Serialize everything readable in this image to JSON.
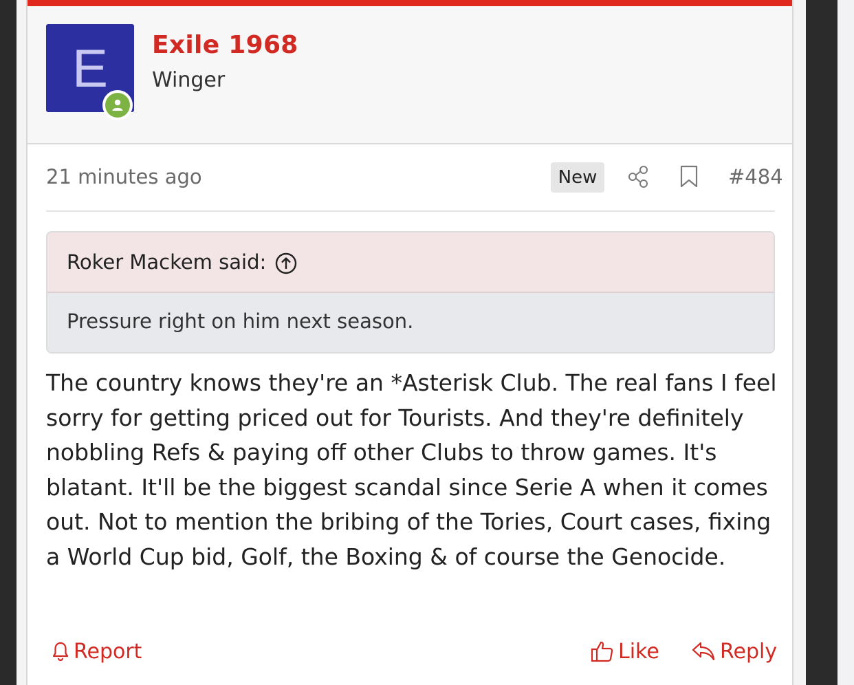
{
  "post": {
    "author": {
      "avatar_letter": "E",
      "name": "Exile 1968",
      "title": "Winger",
      "online_icon": "user-online-icon"
    },
    "meta": {
      "timestamp": "21 minutes ago",
      "new_badge": "New",
      "share_icon": "share-icon",
      "bookmark_icon": "bookmark-icon",
      "post_number": "#484"
    },
    "quote": {
      "author_line": "Roker Mackem said:",
      "jump_icon": "arrow-up-circle-icon",
      "text": "Pressure right on him next season."
    },
    "message": "The country knows they're an *Asterisk Club. The real fans I feel sorry for getting priced out for Tourists. And they're definitely nobbling Refs & paying off other Clubs to throw games. It's blatant. It'll be the biggest scandal since Serie A when it comes out. Not to mention the bribing of the Tories, Court cases, fixing a World Cup bid, Golf, the Boxing & of course the Genocide.",
    "actions": {
      "report": "Report",
      "like": "Like",
      "reply": "Reply"
    }
  },
  "colors": {
    "accent_red": "#d12a22",
    "header_strip": "#e0281f",
    "avatar_bg": "#2c2fa0",
    "online_green": "#7cb342",
    "quote_head_bg": "#f3e4e6",
    "quote_body_bg": "#e7e9ec"
  }
}
